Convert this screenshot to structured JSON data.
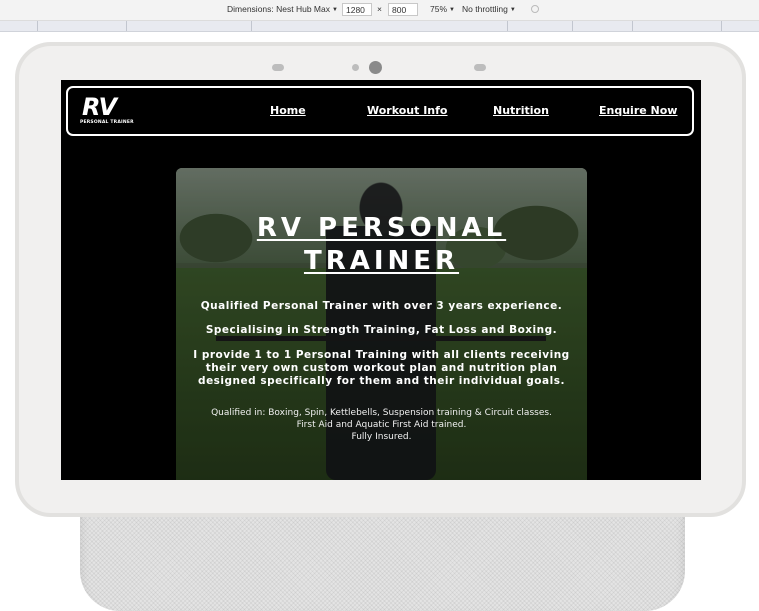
{
  "devtools": {
    "dimensions_label": "Dimensions: Nest Hub Max",
    "width_value": "1280",
    "times": "×",
    "height_value": "800",
    "zoom": "75%",
    "throttling": "No throttling"
  },
  "site": {
    "logo_text": "RV",
    "logo_tagline": "PERSONAL TRAINER",
    "nav": {
      "home": "Home",
      "workout": "Workout Info",
      "nutrition": "Nutrition",
      "enquire": "Enquire Now"
    },
    "hero": {
      "title_line1": "RV PERSONAL",
      "title_line2": "TRAINER",
      "p1": "Qualified Personal Trainer with over 3 years experience.",
      "p2": "Specialising in Strength Training, Fat Loss and Boxing.",
      "p3_line1": "I provide 1 to 1 Personal Training with all clients receiving",
      "p3_line2": "their very own custom workout plan and nutrition plan",
      "p3_line3": "designed specifically for them and their individual goals.",
      "q1": "Qualified in: Boxing, Spin, Kettlebells, Suspension training & Circuit classes.",
      "q2": "First Aid and Aquatic First Aid trained.",
      "q3": "Fully Insured."
    }
  },
  "colors": {
    "screen_bg": "#000000",
    "text": "#ffffff",
    "bezel": "#f1f0ef"
  }
}
